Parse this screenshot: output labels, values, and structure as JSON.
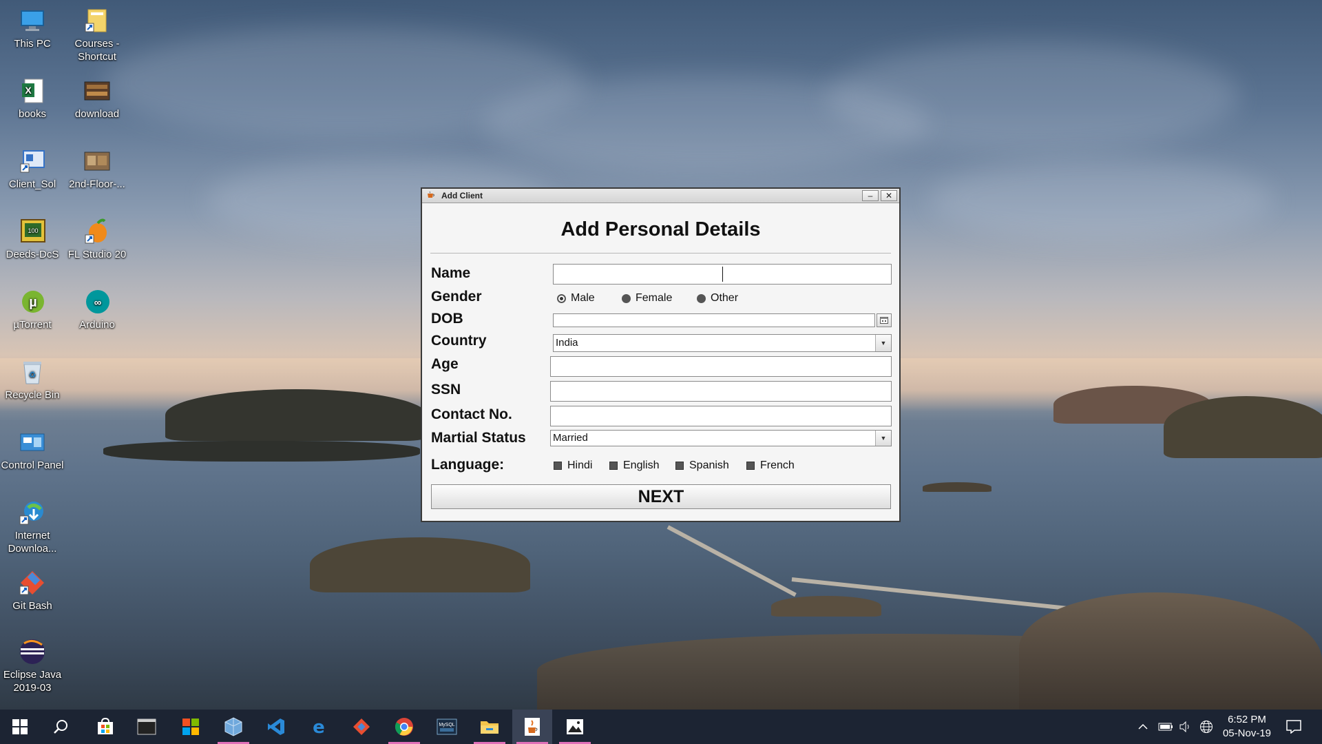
{
  "desktop": {
    "icons": [
      {
        "label": "This PC",
        "icon": "computer-icon"
      },
      {
        "label": "Courses -\nShortcut",
        "icon": "folder-shortcut-icon"
      },
      {
        "label": "books",
        "icon": "excel-icon"
      },
      {
        "label": "download",
        "icon": "image-thumbnail-icon"
      },
      {
        "label": "Client_Sol",
        "icon": "app-shortcut-icon"
      },
      {
        "label": "2nd-Floor-...",
        "icon": "image-thumbnail-icon"
      },
      {
        "label": "Deeds-DcS",
        "icon": "circuit-app-icon"
      },
      {
        "label": "FL Studio 20",
        "icon": "fl-studio-icon"
      },
      {
        "label": "µTorrent",
        "icon": "utorrent-icon"
      },
      {
        "label": "Arduino",
        "icon": "arduino-icon"
      },
      {
        "label": "Recycle Bin",
        "icon": "recycle-bin-icon"
      },
      {
        "label": "Control Panel",
        "icon": "control-panel-icon"
      },
      {
        "label": "Internet\nDownloa...",
        "icon": "download-manager-icon"
      },
      {
        "label": "Git Bash",
        "icon": "git-bash-icon"
      },
      {
        "label": "Eclipse Java\n2019-03",
        "icon": "eclipse-icon"
      }
    ]
  },
  "window": {
    "title": "Add Client",
    "minimize": "–",
    "close": "✕",
    "heading": "Add Personal Details",
    "labels": {
      "name": "Name",
      "gender": "Gender",
      "dob": "DOB",
      "country": "Country",
      "age": "Age",
      "ssn": "SSN",
      "contact": "Contact No.",
      "marital": "Martial Status",
      "language": "Language:"
    },
    "name_value": "",
    "dob_value": "",
    "age_value": "",
    "ssn_value": "",
    "contact_value": "",
    "gender_options": [
      "Male",
      "Female",
      "Other"
    ],
    "gender_selected": "Male",
    "country_value": "India",
    "marital_value": "Married",
    "languages": [
      "Hindi",
      "English",
      "Spanish",
      "French"
    ],
    "next_label": "NEXT"
  },
  "taskbar": {
    "apps": [
      "start-icon",
      "search-icon",
      "store-icon",
      "terminal-icon",
      "office-icon",
      "virtualbox-icon",
      "vscode-icon",
      "edge-icon",
      "git-icon",
      "chrome-icon",
      "mysql-icon",
      "file-explorer-icon",
      "java-icon",
      "photos-icon"
    ],
    "time": "6:52 PM",
    "date": "05-Nov-19"
  },
  "colors": {
    "taskbar": "#1c2433",
    "active_underline": "#e070b8",
    "window_bg": "#f5f5f5"
  }
}
